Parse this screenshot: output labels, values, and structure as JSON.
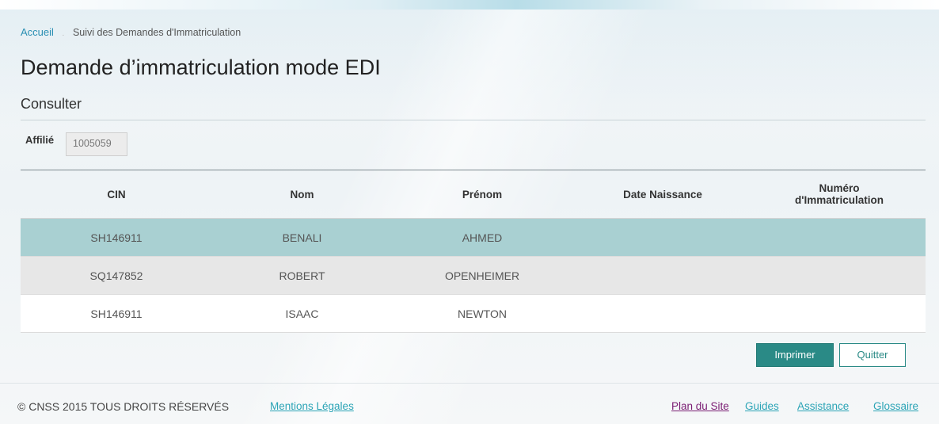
{
  "breadcrumb": {
    "home": "Accueil",
    "separator": ".",
    "current": "Suivi des Demandes d'Immatriculation"
  },
  "page_title": "Demande d’immatriculation mode EDI",
  "section_title": "Consulter",
  "affilie": {
    "label": "Affilié",
    "value": "1005059"
  },
  "table": {
    "headers": {
      "cin": "CIN",
      "nom": "Nom",
      "prenom": "Prénom",
      "date_naissance": "Date Naissance",
      "numero_line1": "Numéro",
      "numero_line2": "d'Immatriculation"
    },
    "rows": [
      {
        "cin": "SH146911",
        "nom": "BENALI",
        "prenom": "AHMED",
        "date_naissance": "",
        "numero": ""
      },
      {
        "cin": "SQ147852",
        "nom": "ROBERT",
        "prenom": "OPENHEIMER",
        "date_naissance": "",
        "numero": ""
      },
      {
        "cin": "SH146911",
        "nom": "ISAAC",
        "prenom": "NEWTON",
        "date_naissance": "",
        "numero": ""
      }
    ]
  },
  "actions": {
    "print_label": "Imprimer",
    "quit_label": "Quitter"
  },
  "footer": {
    "copyright": "© CNSS 2015 TOUS DROITS RÉSERVÉS",
    "mentions": "Mentions Légales",
    "plan": "Plan du Site",
    "guides": "Guides",
    "assistance": "Assistance",
    "glossaire": "Glossaire"
  },
  "colors": {
    "accent": "#2a8a86",
    "link": "#2ba4b6",
    "visited_link": "#7a1d73",
    "selected_row": "#a9d0d2"
  }
}
